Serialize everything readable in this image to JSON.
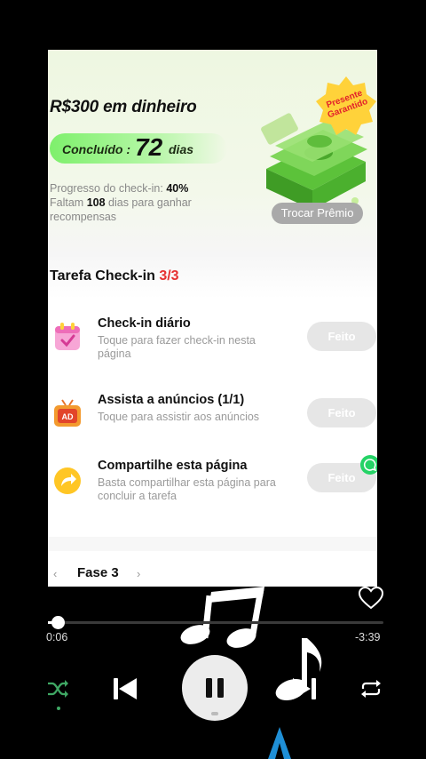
{
  "reward": {
    "title": "R$300 em dinheiro",
    "completed_label": "Concluído :",
    "completed_days": "72",
    "completed_unit": "dias",
    "progress_prefix": "Progresso do check-in:",
    "progress_value": "40%",
    "remaining_prefix": "Faltam",
    "remaining_days": "108",
    "remaining_suffix": "dias para ganhar recompensas",
    "badge": "Presente Garantido",
    "exchange_button": "Trocar Prêmio"
  },
  "tasks": {
    "title": "Tarefa Check-in",
    "count": "3/3",
    "items": [
      {
        "title": "Check-in diário",
        "subtitle": "Toque para fazer check-in nesta página",
        "button": "Feito",
        "icon": "calendar-icon"
      },
      {
        "title": "Assista a anúncios  (1/1)",
        "subtitle": "Toque para assistir aos anúncios",
        "button": "Feito",
        "icon": "ad-tv-icon"
      },
      {
        "title": "Compartilhe esta página",
        "subtitle": "Basta compartilhar esta página para concluir a tarefa",
        "button": "Feito",
        "icon": "share-icon"
      }
    ]
  },
  "phase": {
    "prev_glyph": "‹",
    "label": "Fase 3",
    "next_glyph": "›"
  },
  "player": {
    "elapsed": "0:06",
    "remaining": "-3:39",
    "progress": 0.028,
    "accent": "#3fa864",
    "controls": [
      "shuffle-icon",
      "previous-icon",
      "pause-icon",
      "next-icon",
      "repeat-icon",
      "heart-icon"
    ]
  }
}
